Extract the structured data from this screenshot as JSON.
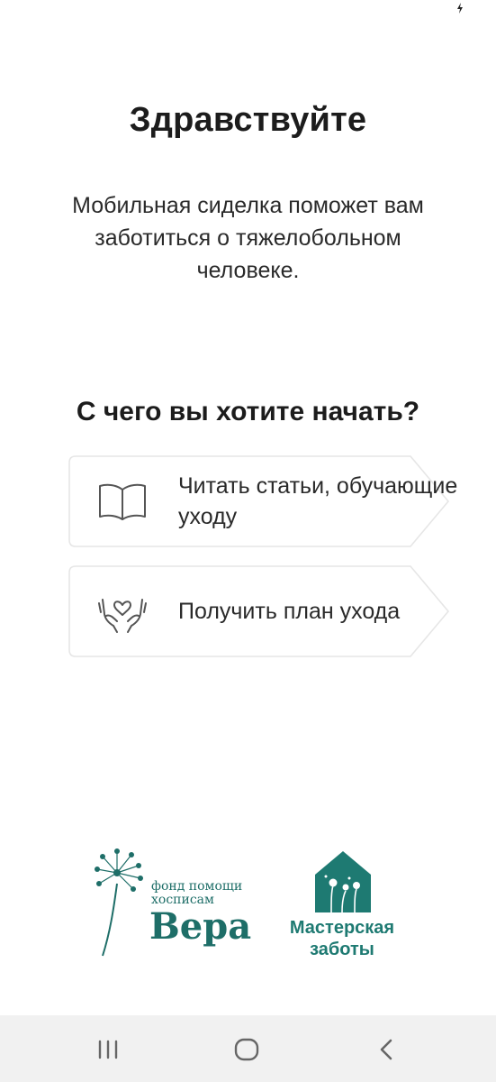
{
  "screen": {
    "title": "Здравствуйте",
    "subtitle": "Мобильная сиделка поможет вам заботиться о тяжелобольном человеке.",
    "question": "С чего вы хотите начать?"
  },
  "options": [
    {
      "label": "Читать статьи, обучающие уходу",
      "icon": "book-icon"
    },
    {
      "label": "Получить план ухода",
      "icon": "caring-hands-icon"
    }
  ],
  "logos": {
    "vera": {
      "line1": "фонд помощи",
      "line2": "хосписам",
      "name": "Вера"
    },
    "master": {
      "line1": "Мастерская",
      "line2": "заботы"
    }
  },
  "status_bar": {
    "icon": "charging-icon"
  },
  "nav_bar": {
    "icons": [
      "recent-apps-icon",
      "home-icon",
      "back-icon"
    ]
  },
  "colors": {
    "brand_teal": "#1e6e68",
    "master_teal": "#1e7a72",
    "text": "#1c1c1c",
    "card_border": "#e6e6e6",
    "nav_bg": "#f1f1f1"
  }
}
